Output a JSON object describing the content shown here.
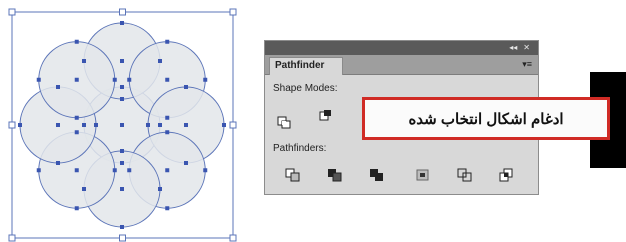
{
  "pathfinder_panel": {
    "tab_label": "Pathfinder",
    "topbar_buttons": [
      "◂◂",
      "✕"
    ],
    "menu_icon": "▾≡",
    "shape_modes_label": "Shape Modes:",
    "pathfinders_label": "Pathfinders:",
    "shape_mode_buttons": [
      "unite-icon",
      "minus-front-icon"
    ],
    "pathfinder_buttons": [
      "divide-icon",
      "trim-icon",
      "merge-icon",
      "crop-icon",
      "outline-icon",
      "minus-back-icon"
    ]
  },
  "callout": {
    "text": "ادغام اشکال انتخاب شده"
  },
  "colors": {
    "shape_stroke": "#5b74b8",
    "shape_fill": "#e3e6ea",
    "anchor": "#3a55b0",
    "callout_border": "#d02b25",
    "arrow": "#e03a2c"
  }
}
